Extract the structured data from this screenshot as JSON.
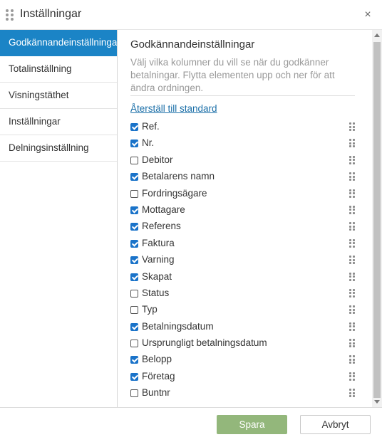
{
  "dialog": {
    "title": "Inställningar",
    "close_symbol": "×"
  },
  "sidebar": {
    "items": [
      {
        "label": "Godkännandeinställningar",
        "active": true
      },
      {
        "label": "Totalinställning",
        "active": false
      },
      {
        "label": "Visningstäthet",
        "active": false
      },
      {
        "label": "Inställningar",
        "active": false
      },
      {
        "label": "Delningsinställning",
        "active": false
      }
    ]
  },
  "main": {
    "heading": "Godkännandeinställningar",
    "description": "Välj vilka kolumner du vill se när du godkänner betalningar. Flytta elementen upp och ner för att ändra ordningen.",
    "reset_link": "Återställ till standard",
    "columns": [
      {
        "label": "Ref.",
        "checked": true
      },
      {
        "label": "Nr.",
        "checked": true
      },
      {
        "label": "Debitor",
        "checked": false
      },
      {
        "label": "Betalarens namn",
        "checked": true
      },
      {
        "label": "Fordringsägare",
        "checked": false
      },
      {
        "label": "Mottagare",
        "checked": true
      },
      {
        "label": "Referens",
        "checked": true
      },
      {
        "label": "Faktura",
        "checked": true
      },
      {
        "label": "Varning",
        "checked": true
      },
      {
        "label": "Skapat",
        "checked": true
      },
      {
        "label": "Status",
        "checked": false
      },
      {
        "label": "Typ",
        "checked": false
      },
      {
        "label": "Betalningsdatum",
        "checked": true
      },
      {
        "label": "Ursprungligt betalningsdatum",
        "checked": false
      },
      {
        "label": "Belopp",
        "checked": true
      },
      {
        "label": "Företag",
        "checked": true
      },
      {
        "label": "Buntnr",
        "checked": false
      }
    ]
  },
  "footer": {
    "save_label": "Spara",
    "cancel_label": "Avbryt"
  },
  "colors": {
    "accent": "#1b84c6",
    "checkbox": "#1a73c9",
    "save_button": "#93b77b",
    "link": "#1b6fa8"
  }
}
